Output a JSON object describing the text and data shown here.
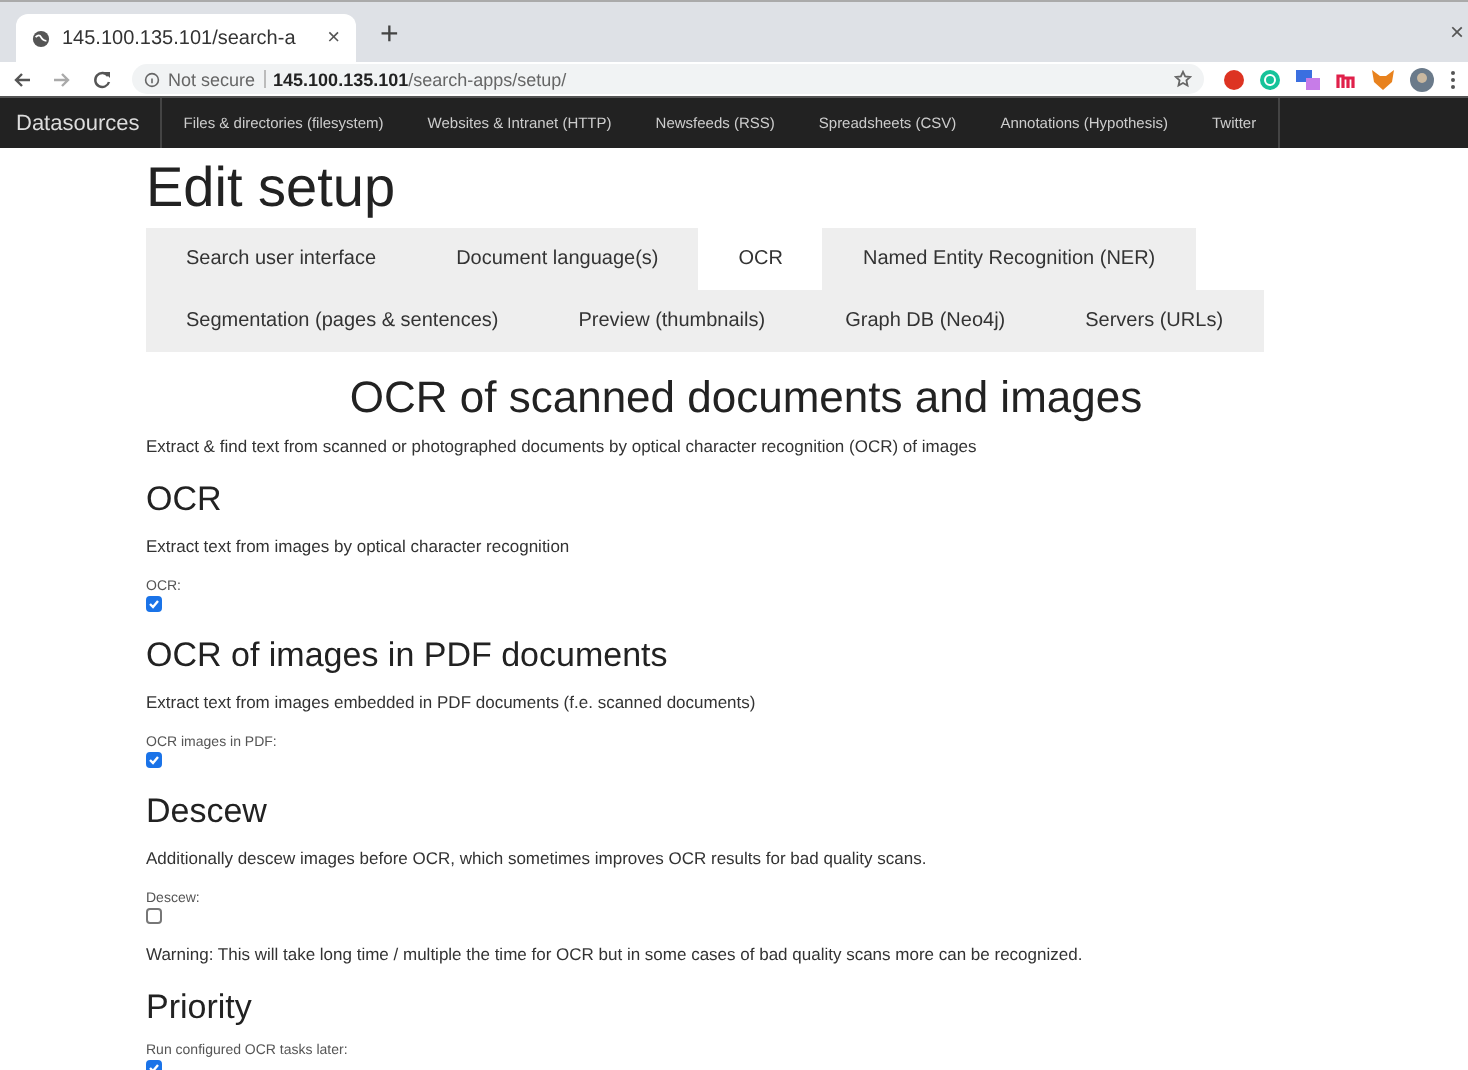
{
  "browser": {
    "tab_title": "145.100.135.101/search-a",
    "tab_close": "×",
    "new_tab": "+",
    "window_close": "×",
    "security": "Not secure",
    "url_host": "145.100.135.101",
    "url_path": "/search-apps/setup/"
  },
  "navbar": {
    "brand": "Datasources",
    "items": [
      "Files & directories (filesystem)",
      "Websites & Intranet (HTTP)",
      "Newsfeeds (RSS)",
      "Spreadsheets (CSV)",
      "Annotations (Hypothesis)",
      "Twitter"
    ]
  },
  "page_title": "Edit setup",
  "tabs": [
    {
      "label": "Search user interface",
      "selected": false
    },
    {
      "label": "Document language(s)",
      "selected": false
    },
    {
      "label": "OCR",
      "selected": true
    },
    {
      "label": "Named Entity Recognition (NER)",
      "selected": false
    },
    {
      "label": "Segmentation (pages & sentences)",
      "selected": false
    },
    {
      "label": "Preview (thumbnails)",
      "selected": false
    },
    {
      "label": "Graph DB (Neo4j)",
      "selected": false
    },
    {
      "label": "Servers (URLs)",
      "selected": false
    }
  ],
  "heading": "OCR of scanned documents and images",
  "intro": "Extract & find text from scanned or photographed documents by optical character recognition (OCR) of images",
  "sections": [
    {
      "title": "OCR",
      "description": "Extract text from images by optical character recognition",
      "field": {
        "label": "OCR:",
        "checked": true
      }
    },
    {
      "title": "OCR of images in PDF documents",
      "description": "Extract text from images embedded in PDF documents (f.e. scanned documents)",
      "field": {
        "label": "OCR images in PDF:",
        "checked": true
      }
    },
    {
      "title": "Descew",
      "description": "Additionally descew images before OCR, which sometimes improves OCR results for bad quality scans.",
      "field": {
        "label": "Descew:",
        "checked": false
      },
      "warning": "Warning: This will take long time / multiple the time for OCR but in some cases of bad quality scans more can be recognized."
    },
    {
      "title": "Priority",
      "field": {
        "label": "Run configured OCR tasks later:",
        "checked": true
      }
    }
  ]
}
